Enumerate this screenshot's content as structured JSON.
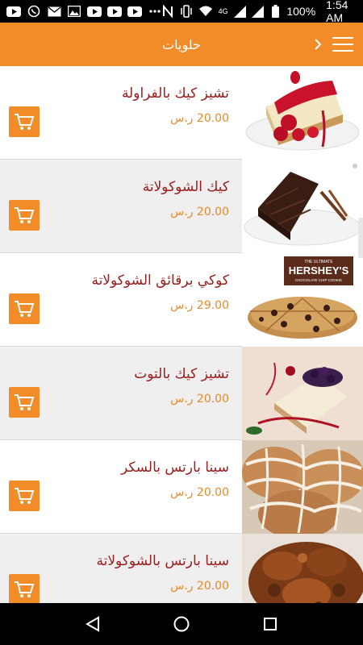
{
  "status_bar": {
    "battery": "100%",
    "time": "1:54 AM",
    "network": "4G",
    "left_icons": [
      "youtube-icon",
      "whatsapp-icon",
      "mail-icon",
      "image-icon",
      "youtube-icon",
      "youtube-icon",
      "youtube-icon",
      "more-dots-icon"
    ],
    "right_icons": [
      "nfc-icon",
      "vibrate-icon",
      "wifi-icon",
      "signal-icon",
      "signal-icon",
      "battery-icon"
    ]
  },
  "app_bar": {
    "title": "حلويات"
  },
  "colors": {
    "accent": "#f28c28",
    "name_text": "#9b1c1c",
    "price_text": "#e8892b",
    "alt_row": "#efefef"
  },
  "items": [
    {
      "name": "تشيز كيك بالفراولة",
      "price": "20.00 ر.س",
      "image": "strawberry-cheesecake"
    },
    {
      "name": "كيك الشوكولاتة",
      "price": "20.00 ر.س",
      "image": "chocolate-cake"
    },
    {
      "name": "كوكي برقائق الشوكولاتة",
      "price": "29.00 ر.س",
      "image": "chocolate-chip-cookie",
      "brand": "HERSHEY'S",
      "brand_top": "THE ULTIMATE",
      "brand_sub": "CHOCOLATE CHIP COOKIE"
    },
    {
      "name": "تشيز كيك بالتوت",
      "price": "20.00 ر.س",
      "image": "berry-cheesecake"
    },
    {
      "name": "سينا بارتس بالسكر",
      "price": "20.00 ر.س",
      "image": "cinnamon-sugar"
    },
    {
      "name": "سينا بارتس بالشوكولاتة",
      "price": "20.00 ر.س",
      "image": "cinnamon-chocolate"
    }
  ]
}
